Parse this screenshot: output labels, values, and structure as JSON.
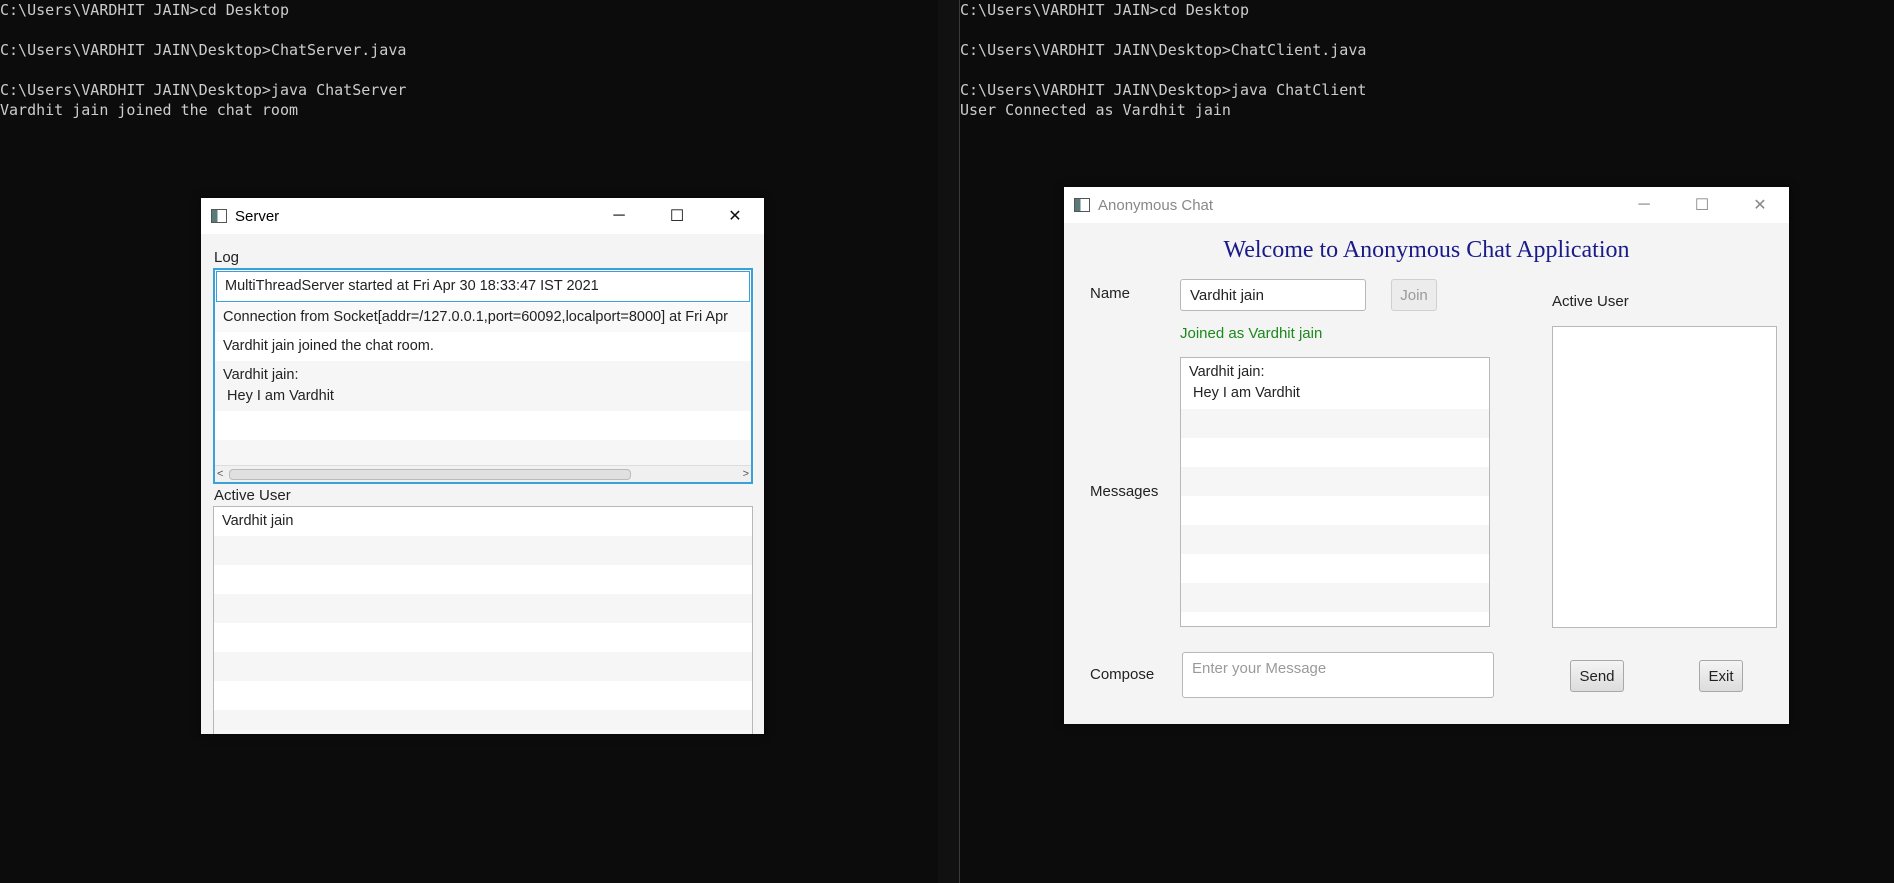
{
  "console_left": {
    "lines": [
      "C:\\Users\\VARDHIT JAIN>cd Desktop",
      "",
      "C:\\Users\\VARDHIT JAIN\\Desktop>ChatServer.java",
      "",
      "C:\\Users\\VARDHIT JAIN\\Desktop>java ChatServer",
      "Vardhit jain joined the chat room"
    ]
  },
  "console_right": {
    "lines": [
      "C:\\Users\\VARDHIT JAIN>cd Desktop",
      "",
      "C:\\Users\\VARDHIT JAIN\\Desktop>ChatClient.java",
      "",
      "C:\\Users\\VARDHIT JAIN\\Desktop>java ChatClient",
      "User Connected as Vardhit jain"
    ]
  },
  "server": {
    "title": "Server",
    "log_label": "Log",
    "log_rows": [
      "MultiThreadServer started at Fri Apr 30 18:33:47 IST 2021",
      "Connection from Socket[addr=/127.0.0.1,port=60092,localport=8000] at Fri Apr",
      "Vardhit jain joined the chat room."
    ],
    "log_message_from": "Vardhit jain:",
    "log_message_text": " Hey I am Vardhit",
    "active_label": "Active User",
    "active_users": [
      "Vardhit jain"
    ]
  },
  "client": {
    "title": "Anonymous Chat",
    "heading": "Welcome to Anonymous Chat Application",
    "name_label": "Name",
    "name_value": "Vardhit jain",
    "join_label": "Join",
    "joined_status": "Joined as Vardhit jain",
    "messages_label": "Messages",
    "message_from": "Vardhit jain:",
    "message_text": " Hey I am Vardhit",
    "active_label": "Active User",
    "compose_label": "Compose",
    "compose_placeholder": "Enter your Message",
    "send_label": "Send",
    "exit_label": "Exit"
  },
  "window_controls": {
    "minimize": "─",
    "maximize": "☐",
    "close": "✕"
  }
}
